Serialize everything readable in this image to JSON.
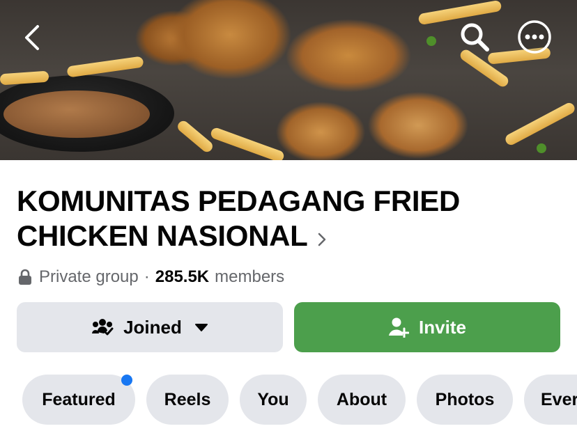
{
  "header": {
    "cover_image": "fried-chicken-cover-photo",
    "back_icon": "chevron-left-icon",
    "search_icon": "search-icon",
    "more_icon": "more-horizontal-icon"
  },
  "group": {
    "name": "KOMUNITAS PEDAGANG FRIED CHICKEN NASIONAL",
    "privacy": "Private group",
    "separator": "·",
    "member_count": "285.5K",
    "members_label": "members"
  },
  "actions": {
    "joined_label": "Joined",
    "invite_label": "Invite",
    "accent_color": "#4c9f4c"
  },
  "tabs": [
    {
      "label": "Featured",
      "has_badge": true
    },
    {
      "label": "Reels"
    },
    {
      "label": "You"
    },
    {
      "label": "About"
    },
    {
      "label": "Photos"
    },
    {
      "label": "Ever"
    }
  ],
  "badge_color": "#1877f2"
}
